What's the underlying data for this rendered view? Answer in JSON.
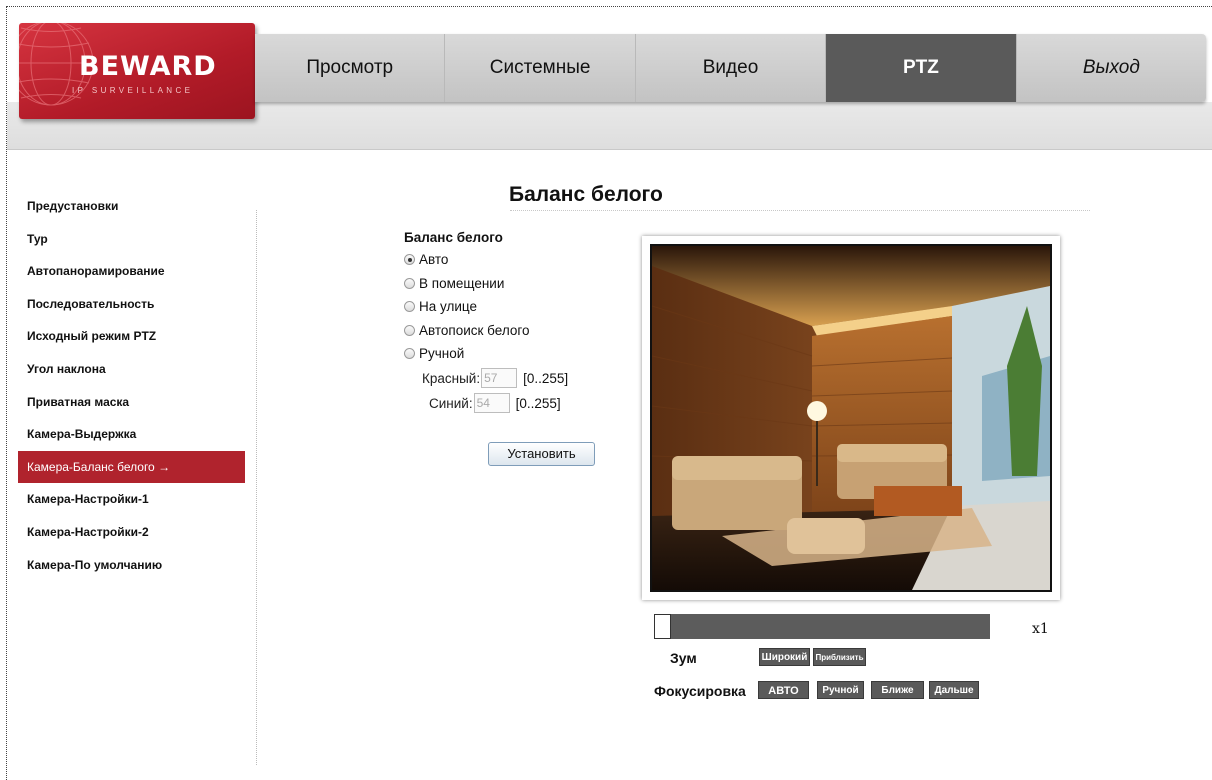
{
  "brand": {
    "name": "BEWARD",
    "tagline": "IP SURVEILLANCE"
  },
  "nav": {
    "tabs": [
      {
        "label": "Просмотр",
        "active": false
      },
      {
        "label": "Системные",
        "active": false
      },
      {
        "label": "Видео",
        "active": false
      },
      {
        "label": "PTZ",
        "active": true
      },
      {
        "label": "Выход",
        "active": false
      }
    ]
  },
  "sidebar": {
    "items": [
      {
        "label": "Предустановки"
      },
      {
        "label": "Тур"
      },
      {
        "label": "Автопанорамирование"
      },
      {
        "label": "Последовательность"
      },
      {
        "label": "Исходный режим PTZ"
      },
      {
        "label": "Угол наклона"
      },
      {
        "label": "Приватная маска"
      },
      {
        "label": "Камера-Выдержка"
      },
      {
        "label": "Камера-Баланс белого",
        "active": true,
        "arrow": "→"
      },
      {
        "label": "Камера-Настройки-1"
      },
      {
        "label": "Камера-Настройки-2"
      },
      {
        "label": "Камера-По умолчанию"
      }
    ]
  },
  "page": {
    "title": "Баланс белого"
  },
  "form": {
    "heading": "Баланс белого",
    "options": [
      {
        "label": "Авто",
        "checked": true
      },
      {
        "label": "В помещении",
        "checked": false
      },
      {
        "label": "На улице",
        "checked": false
      },
      {
        "label": "Автопоиск белого",
        "checked": false
      },
      {
        "label": "Ручной",
        "checked": false
      }
    ],
    "red": {
      "label": "Красный:",
      "value": "57",
      "range": "[0..255]"
    },
    "blue": {
      "label": "Синий:",
      "value": "54",
      "range": "[0..255]"
    },
    "submit_label": "Установить"
  },
  "ptz": {
    "zoom_level": "x1",
    "zoom_position": 0,
    "zoom_label": "Зум",
    "zoom_wide": "Широкий",
    "zoom_tele": "Приблизить",
    "focus_label": "Фокусировка",
    "focus_auto": "АВТО",
    "focus_manual": "Ручной",
    "focus_near": "Ближе",
    "focus_far": "Дальше"
  },
  "colors": {
    "accent": "#b0232d",
    "active_tab": "#5a5a5a"
  }
}
